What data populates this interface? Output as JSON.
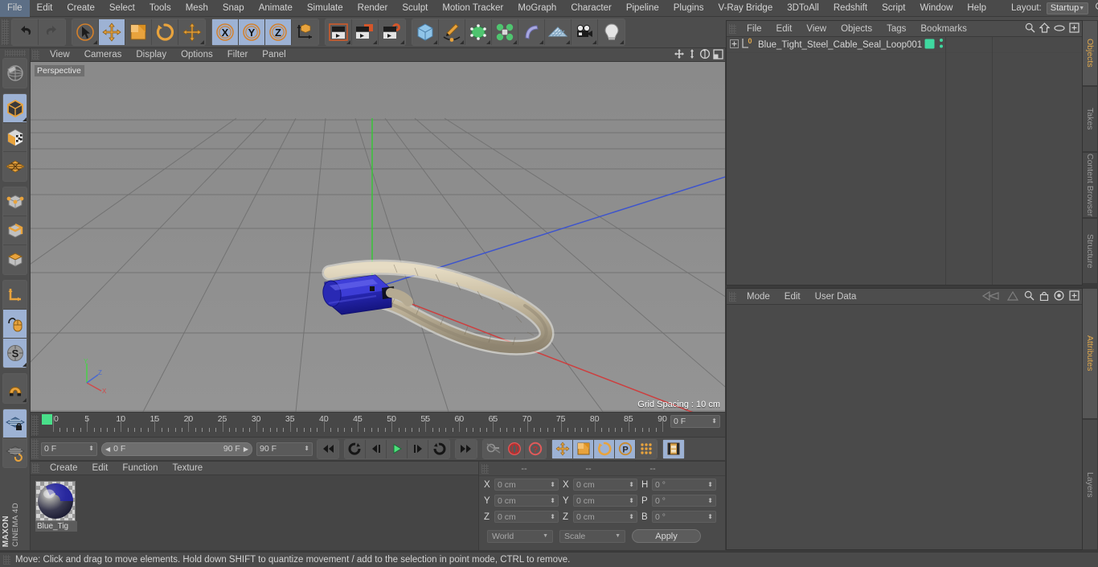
{
  "menubar": {
    "items": [
      "File",
      "Edit",
      "Create",
      "Select",
      "Tools",
      "Mesh",
      "Snap",
      "Animate",
      "Simulate",
      "Render",
      "Sculpt",
      "Motion Tracker",
      "MoGraph",
      "Character",
      "Pipeline",
      "Plugins",
      "V-Ray Bridge",
      "3DToAll",
      "Redshift",
      "Script",
      "Window",
      "Help"
    ],
    "layout_label": "Layout:",
    "layout_value": "Startup",
    "search_icon": "search-icon"
  },
  "toolbar": {
    "groups": [
      {
        "name": "undo-redo",
        "buttons": [
          {
            "name": "undo",
            "icon": "undo-arrow-icon",
            "active": false
          },
          {
            "name": "redo",
            "icon": "redo-arrow-icon",
            "active": false
          }
        ]
      },
      {
        "name": "transform-tools",
        "buttons": [
          {
            "name": "select",
            "icon": "cursor-select-icon",
            "active": false
          },
          {
            "name": "move",
            "icon": "move-cross-icon",
            "active": true
          },
          {
            "name": "scale",
            "icon": "scale-box-icon",
            "active": false
          },
          {
            "name": "rotate",
            "icon": "rotate-circle-icon",
            "active": false
          },
          {
            "name": "transform",
            "icon": "move-cross-icon",
            "active": false
          }
        ]
      },
      {
        "name": "axis-locks",
        "buttons": [
          {
            "name": "x-axis",
            "icon": "x-axis-icon",
            "active": true
          },
          {
            "name": "y-axis",
            "icon": "y-axis-icon",
            "active": true
          },
          {
            "name": "z-axis",
            "icon": "z-axis-icon",
            "active": true
          },
          {
            "name": "world-object-axis",
            "icon": "world-axis-cube-icon",
            "active": false
          }
        ]
      },
      {
        "name": "render-tools",
        "buttons": [
          {
            "name": "render-view",
            "icon": "clapboard-icon",
            "active": false
          },
          {
            "name": "render-to-picture-viewer",
            "icon": "clapboard-window-icon",
            "active": false
          },
          {
            "name": "render-settings",
            "icon": "clapboard-gear-icon",
            "active": false
          }
        ]
      },
      {
        "name": "object-creation",
        "buttons": [
          {
            "name": "add-cube",
            "icon": "blue-cube-icon",
            "active": false
          },
          {
            "name": "add-spline",
            "icon": "pen-spline-icon",
            "active": false
          },
          {
            "name": "add-generator",
            "icon": "green-cube-icon",
            "active": false
          },
          {
            "name": "add-array",
            "icon": "green-cluster-icon",
            "active": false
          },
          {
            "name": "add-deformer",
            "icon": "purple-bend-icon",
            "active": false
          },
          {
            "name": "add-environment",
            "icon": "floor-grid-icon",
            "active": false
          },
          {
            "name": "add-camera",
            "icon": "camera-icon",
            "active": false
          },
          {
            "name": "add-light",
            "icon": "lightbulb-icon",
            "active": false
          }
        ]
      }
    ]
  },
  "lefttoolbar": {
    "groups": [
      {
        "buttons": [
          {
            "name": "make-editable",
            "icon": "globe-editable-icon",
            "active": false
          }
        ]
      },
      {
        "buttons": [
          {
            "name": "model-mode",
            "icon": "model-cube-icon",
            "active": true
          },
          {
            "name": "texture-mode",
            "icon": "texture-cube-icon",
            "active": false
          },
          {
            "name": "uv-mode",
            "icon": "uv-mesh-icon",
            "active": false
          }
        ]
      },
      {
        "buttons": [
          {
            "name": "points-mode",
            "icon": "points-cube-icon",
            "active": false
          },
          {
            "name": "edges-mode",
            "icon": "edges-cube-icon",
            "active": false
          },
          {
            "name": "polygons-mode",
            "icon": "polygons-cube-icon",
            "active": false
          }
        ]
      },
      {
        "buttons": [
          {
            "name": "object-axis-mode",
            "icon": "axis-l-icon",
            "active": false
          },
          {
            "name": "viewport-solo",
            "icon": "mouse-icon",
            "active": true
          },
          {
            "name": "enable-snapping",
            "icon": "snap-s-icon",
            "active": true
          }
        ]
      },
      {
        "buttons": [
          {
            "name": "magnet-tool",
            "icon": "magnet-icon",
            "active": false
          }
        ]
      },
      {
        "buttons": [
          {
            "name": "workplane-lock",
            "icon": "workplane-lock-icon",
            "active": true
          },
          {
            "name": "workplane-rotate",
            "icon": "workplane-rotate-icon",
            "active": false
          }
        ]
      }
    ],
    "brand": "MAXON",
    "product": "CINEMA 4D"
  },
  "viewport": {
    "menu": [
      "View",
      "Cameras",
      "Display",
      "Options",
      "Filter",
      "Panel"
    ],
    "icons": [
      "pan-icon",
      "dolly-icon",
      "rotate-view-icon",
      "maximize-viewport-icon"
    ],
    "perspective_label": "Perspective",
    "grid_spacing": "Grid Spacing : 10 cm",
    "axis_gizmo": {
      "x": "X",
      "y": "Y",
      "z": "Z"
    },
    "scene_object": "Blue_Tight_Steel_Cable_Seal_Loop001",
    "colors": {
      "x_axis": "#d03030",
      "y_axis": "#30c030",
      "z_axis": "#3050d0",
      "cable": "#c9bfa6",
      "housing": "#2b2bb8"
    }
  },
  "timeline": {
    "ticks": [
      0,
      5,
      10,
      15,
      20,
      25,
      30,
      35,
      40,
      45,
      50,
      55,
      60,
      65,
      70,
      75,
      80,
      85,
      90
    ],
    "current_frame_field": "0 F",
    "range_min": 0,
    "range_max": 90
  },
  "animbar": {
    "current_frame": "0 F",
    "range_start": "0 F",
    "range_end": "90 F",
    "end_frame": "90 F",
    "transport": [
      {
        "name": "go-to-start",
        "icon": "skip-start-icon"
      },
      {
        "name": "step-back-keyframe",
        "icon": "prev-key-icon"
      },
      {
        "name": "step-back-frame",
        "icon": "prev-frame-icon"
      },
      {
        "name": "play",
        "icon": "play-icon"
      },
      {
        "name": "step-forward-frame",
        "icon": "next-frame-icon"
      },
      {
        "name": "loop-playback",
        "icon": "loop-icon"
      },
      {
        "name": "go-to-end",
        "icon": "skip-end-icon"
      }
    ],
    "keyframe_tools": [
      {
        "name": "record-active-objects",
        "icon": "key-icon",
        "active": false
      },
      {
        "name": "autokeying",
        "icon": "autokey-red-icon",
        "active": false
      },
      {
        "name": "keyframe-selection",
        "icon": "question-red-icon",
        "active": false
      }
    ],
    "param_tools": [
      {
        "name": "position-key",
        "icon": "move-cross-icon",
        "active": true
      },
      {
        "name": "scale-key",
        "icon": "scale-box-icon",
        "active": true
      },
      {
        "name": "rotation-key",
        "icon": "rotate-circle-icon",
        "active": true
      },
      {
        "name": "parameter-key",
        "icon": "p-circle-icon",
        "active": true
      },
      {
        "name": "point-level-animation",
        "icon": "dots-grid-icon",
        "active": false
      }
    ],
    "timeline_toggle": {
      "name": "timeline-toggle",
      "icon": "film-strip-icon",
      "active": true
    }
  },
  "material_manager": {
    "menu": [
      "Create",
      "Edit",
      "Function",
      "Texture"
    ],
    "materials": [
      {
        "name": "Blue_Tig",
        "color": "#2b2bb8"
      }
    ]
  },
  "coordinates": {
    "headers": [
      "--",
      "--",
      "--"
    ],
    "rows": [
      {
        "pos_label": "X",
        "pos_value": "0 cm",
        "size_label": "X",
        "size_value": "0 cm",
        "rot_label": "H",
        "rot_value": "0 °"
      },
      {
        "pos_label": "Y",
        "pos_value": "0 cm",
        "size_label": "Y",
        "size_value": "0 cm",
        "rot_label": "P",
        "rot_value": "0 °"
      },
      {
        "pos_label": "Z",
        "pos_value": "0 cm",
        "size_label": "Z",
        "size_value": "0 cm",
        "rot_label": "B",
        "rot_value": "0 °"
      }
    ],
    "coord_system": "World",
    "mode": "Scale",
    "apply_label": "Apply"
  },
  "object_manager": {
    "menu": [
      "File",
      "Edit",
      "View",
      "Objects",
      "Tags",
      "Bookmarks"
    ],
    "icons": [
      "search-icon",
      "home-icon",
      "ellipse-icon",
      "add-layer-icon"
    ],
    "objects": [
      {
        "name": "Blue_Tight_Steel_Cable_Seal_Loop001",
        "expand": "+",
        "level_badge": "0",
        "tag_color": "#3fd9a0",
        "visible_dots": "visibility-dots"
      }
    ]
  },
  "attribute_manager": {
    "menu": [
      "Mode",
      "Edit",
      "User Data"
    ],
    "icons": [
      "history-back-icon",
      "history-forward-icon",
      "search-icon",
      "lock-icon",
      "target-icon",
      "add-icon"
    ]
  },
  "right_tabs_top": [
    "Objects",
    "Takes",
    "Content Browser",
    "Structure"
  ],
  "right_tabs_bottom": [
    "Attributes",
    "Layers"
  ],
  "statusbar": {
    "message": "Move: Click and drag to move elements. Hold down SHIFT to quantize movement / add to the selection in point mode, CTRL to remove."
  }
}
